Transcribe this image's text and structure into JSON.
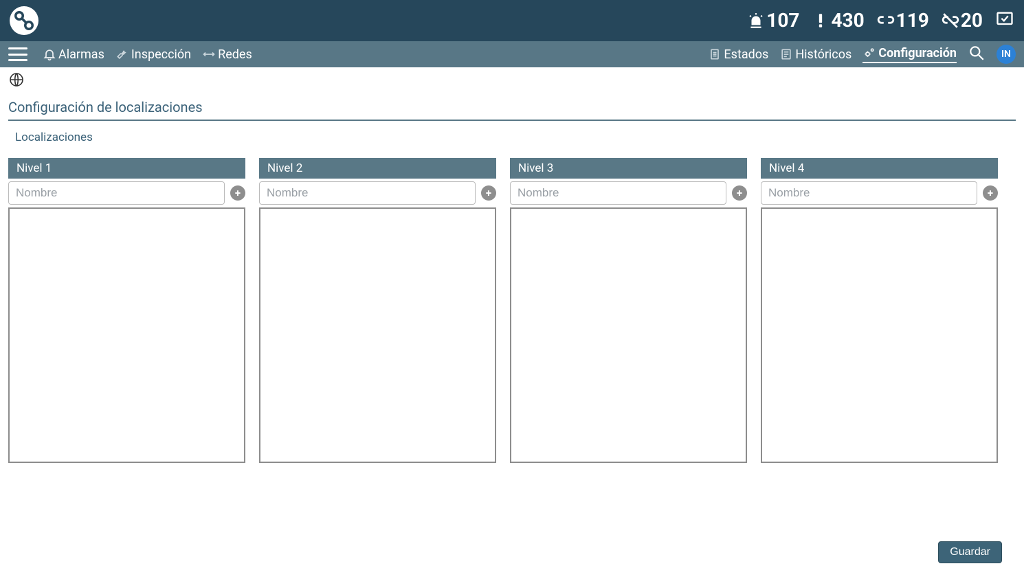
{
  "topbar": {
    "stats": [
      {
        "value": "107"
      },
      {
        "value": "430"
      },
      {
        "value": "119"
      },
      {
        "value": "20"
      }
    ]
  },
  "nav": {
    "left": {
      "alarms": "Alarmas",
      "inspection": "Inspección",
      "networks": "Redes"
    },
    "right": {
      "states": "Estados",
      "history": "Históricos",
      "config": "Configuración"
    },
    "user_initials": "IN"
  },
  "page": {
    "title": "Configuración de localizaciones",
    "section": "Localizaciones"
  },
  "levels": [
    {
      "title": "Nivel 1",
      "placeholder": "Nombre"
    },
    {
      "title": "Nivel 2",
      "placeholder": "Nombre"
    },
    {
      "title": "Nivel 3",
      "placeholder": "Nombre"
    },
    {
      "title": "Nivel 4",
      "placeholder": "Nombre"
    }
  ],
  "buttons": {
    "save": "Guardar",
    "add": "+"
  }
}
